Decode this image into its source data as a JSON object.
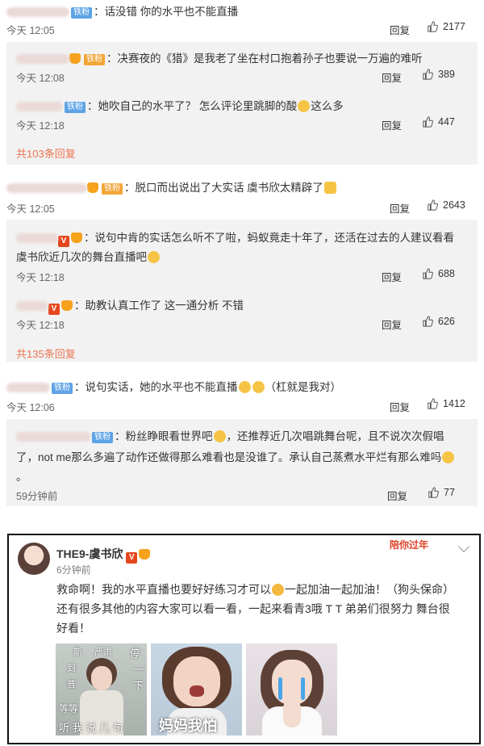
{
  "comments": [
    {
      "user_blur": "   ",
      "badge": "铁粉",
      "text": "：话没错  你的水平也不能直播",
      "time": "今天 12:05",
      "reply": "回复",
      "likes": "2177",
      "sub_replies": [
        {
          "text": "：决赛夜的《猎》是我老了坐在村口抱着孙子也要说一万遍的难听",
          "time": "今天 12:08",
          "reply": "回复",
          "likes": "389"
        },
        {
          "text": "：她吹自己的水平了？ 怎么评论里跳脚的酸",
          "text_after": "这么多",
          "time": "今天 12:18",
          "reply": "回复",
          "likes": "447"
        }
      ],
      "more": "共103条回复"
    },
    {
      "text": "：脱口而出说出了大实话 虞书欣太精辟了",
      "time": "今天 12:05",
      "reply": "回复",
      "likes": "2643",
      "sub_replies": [
        {
          "text": "：说句中肯的实话怎么听不了啦，蚂蚁竟走十年了，还活在过去的人建议看看",
          "text_line2": "虞书欣近几次的舞台直播吧",
          "time": "今天 12:18",
          "reply": "回复",
          "likes": "688"
        },
        {
          "text": "：助教认真工作了 这一通分析 不错",
          "time": "今天 12:18",
          "reply": "回复",
          "likes": "626"
        }
      ],
      "more": "共135条回复"
    },
    {
      "badge": "铁粉",
      "text": "：说句实话，她的水平也不能直播",
      "text_after": "（杠就是我对）",
      "time": "今天 12:06",
      "reply": "回复",
      "likes": "1412",
      "sub_replies": [
        {
          "badge": "铁粉",
          "text": "：粉丝睁眼看世界吧",
          "text_after": "，还推荐近几次唱跳舞台呢，且不说次次假唱",
          "text_line2": "了，not me那么多遍了动作还做得那么难看也是没谁了。承认自己蒸煮水平烂有那么难吗",
          "text_line3": "。",
          "time": "59分钟前",
          "reply": "回复",
          "likes": "77"
        }
      ]
    }
  ],
  "post": {
    "author": "THE9-虞书欣",
    "time": "6分钟前",
    "corner_tag": "陪你过年",
    "line1_a": "救命啊！我的水平直播也要好好练习才可以",
    "line1_b": "一起加油一起加油！（狗头保命）",
    "line2": "还有很多其他的内容大家可以看一看，一起来看青3哦 T T 弟弟们很努力 舞台很",
    "line3": "好看！",
    "image1_text": [
      "斯",
      "严肃",
      "停",
      "到",
      "一",
      "普",
      "下",
      "等等",
      "听 我 说 几 句"
    ],
    "image2_text": "妈妈我怕"
  },
  "colors": {
    "accent": "#eb7350",
    "fan_badge": "#5ea3e6",
    "vip": "#e6471e"
  }
}
